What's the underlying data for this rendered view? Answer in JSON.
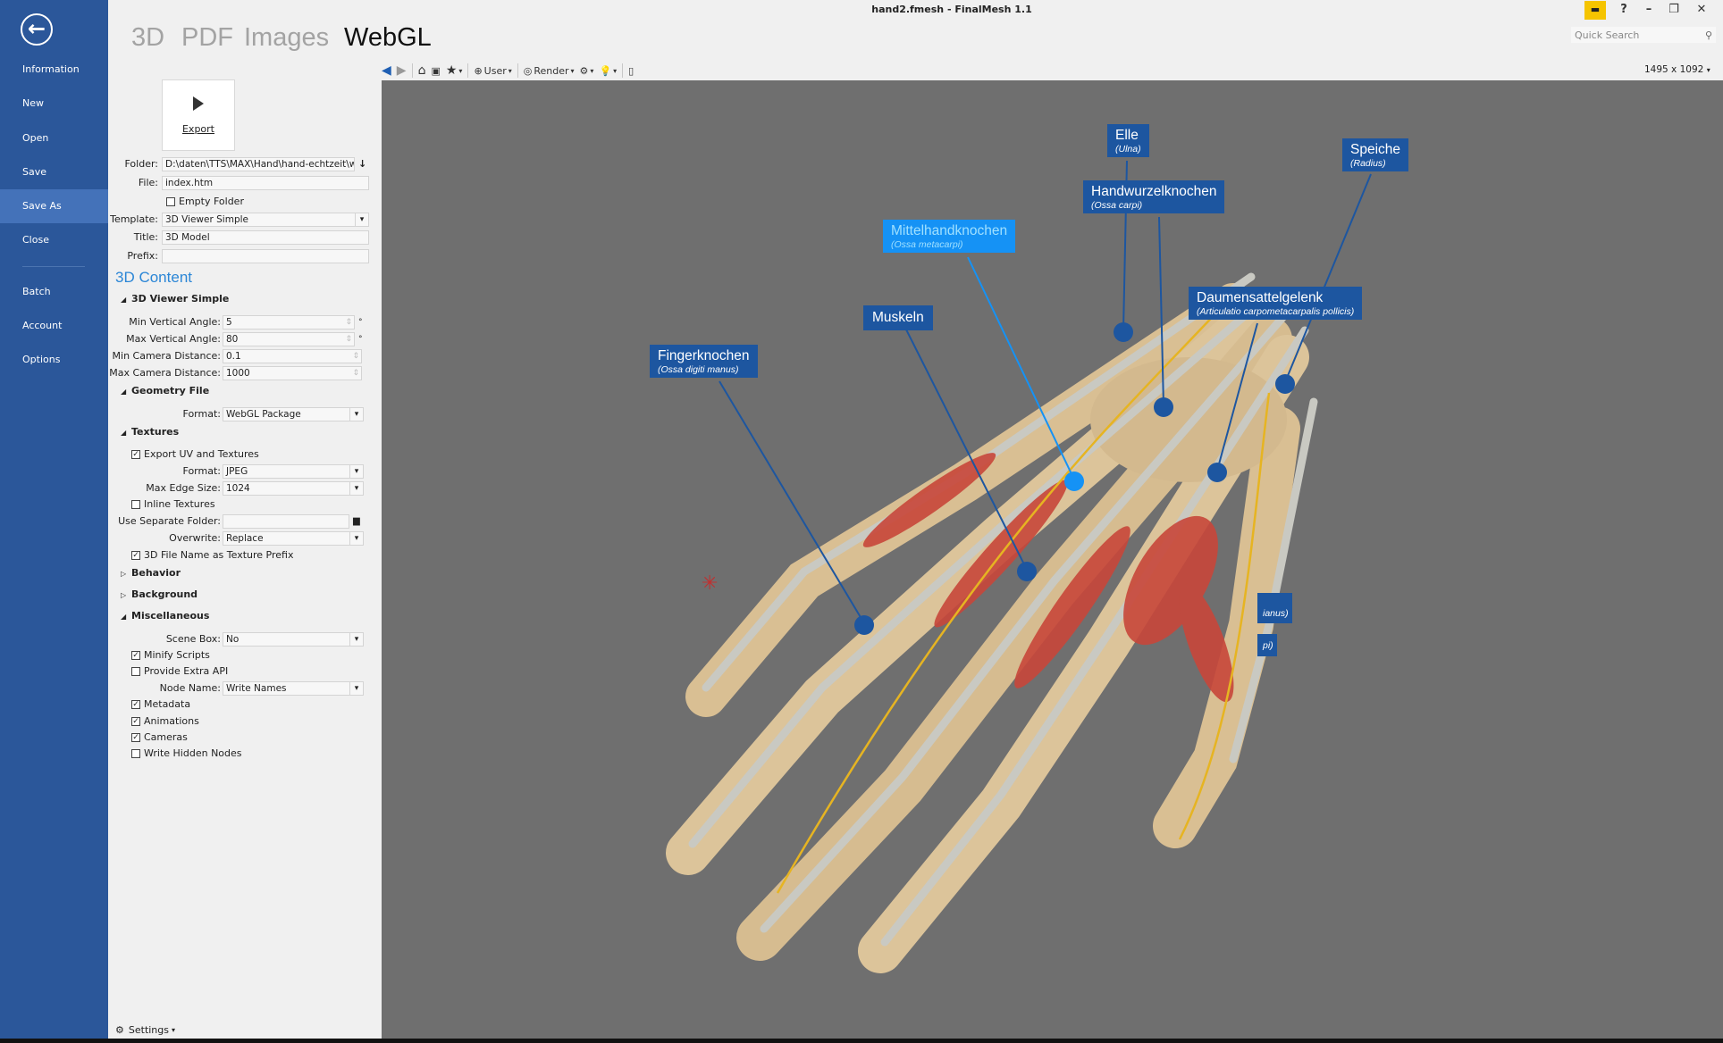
{
  "window": {
    "title": "hand2.fmesh - FinalMesh 1.1",
    "quick_search_placeholder": "Quick Search",
    "resolution": "1495 x 1092"
  },
  "colors": {
    "sidebar": "#2b579a",
    "sidebar_active": "#4472b9",
    "accent": "#2b86d6",
    "label_box": "#1d56a0",
    "label_box_highlight": "#1592f5",
    "viewport": "#6f6f6f"
  },
  "sidebar": {
    "items": [
      {
        "label": "Information"
      },
      {
        "label": "New"
      },
      {
        "label": "Open"
      },
      {
        "label": "Save"
      },
      {
        "label": "Save As",
        "active": true
      },
      {
        "label": "Close"
      },
      {
        "label": "Batch"
      },
      {
        "label": "Account"
      },
      {
        "label": "Options"
      }
    ]
  },
  "tabs": [
    {
      "label": "3D"
    },
    {
      "label": "PDF"
    },
    {
      "label": "Images"
    },
    {
      "label": "WebGL",
      "active": true
    }
  ],
  "export": {
    "label": "Export"
  },
  "form": {
    "folder": {
      "label": "Folder:",
      "value": "D:\\daten\\TTS\\MAX\\Hand\\hand-echtzeit\\wel"
    },
    "file": {
      "label": "File:",
      "value": "index.htm"
    },
    "empty_folder": {
      "label": "Empty Folder",
      "checked": false
    },
    "template": {
      "label": "Template:",
      "value": "3D Viewer Simple"
    },
    "title": {
      "label": "Title:",
      "value": "3D Model"
    },
    "prefix": {
      "label": "Prefix:",
      "value": ""
    }
  },
  "content": {
    "heading": "3D Content",
    "viewer": {
      "title": "3D Viewer Simple",
      "min_vertical_angle": {
        "label": "Min Vertical Angle:",
        "value": "5",
        "unit": "°"
      },
      "max_vertical_angle": {
        "label": "Max Vertical Angle:",
        "value": "80",
        "unit": "°"
      },
      "min_camera_distance": {
        "label": "Min Camera Distance:",
        "value": "0.1"
      },
      "max_camera_distance": {
        "label": "Max Camera Distance:",
        "value": "1000"
      }
    },
    "geometry": {
      "title": "Geometry File",
      "format": {
        "label": "Format:",
        "value": "WebGL Package"
      }
    },
    "textures": {
      "title": "Textures",
      "export_uv": {
        "label": "Export UV and Textures",
        "checked": true
      },
      "format": {
        "label": "Format:",
        "value": "JPEG"
      },
      "max_edge": {
        "label": "Max Edge Size:",
        "value": "1024"
      },
      "inline": {
        "label": "Inline Textures",
        "checked": false
      },
      "separate_folder": {
        "label": "Use Separate Folder:",
        "value": ""
      },
      "overwrite": {
        "label": "Overwrite:",
        "value": "Replace"
      },
      "prefix": {
        "label": "3D File Name as Texture Prefix",
        "checked": true
      }
    },
    "behavior": {
      "title": "Behavior"
    },
    "background": {
      "title": "Background"
    },
    "misc": {
      "title": "Miscellaneous",
      "scene_box": {
        "label": "Scene Box:",
        "value": "No"
      },
      "minify": {
        "label": "Minify Scripts",
        "checked": true
      },
      "extra_api": {
        "label": "Provide Extra API",
        "checked": false
      },
      "node_name": {
        "label": "Node Name:",
        "value": "Write Names"
      },
      "metadata": {
        "label": "Metadata",
        "checked": true
      },
      "animations": {
        "label": "Animations",
        "checked": true
      },
      "cameras": {
        "label": "Cameras",
        "checked": true
      },
      "hidden": {
        "label": "Write Hidden Nodes",
        "checked": false
      }
    }
  },
  "settings": {
    "label": "Settings"
  },
  "toolbar": {
    "user": "User",
    "render": "Render"
  },
  "annotations": [
    {
      "title": "Elle",
      "subtitle": "(Ulna)"
    },
    {
      "title": "Speiche",
      "subtitle": "(Radius)"
    },
    {
      "title": "Handwurzelknochen",
      "subtitle": "(Ossa carpi)"
    },
    {
      "title": "Mittelhandknochen",
      "subtitle": "(Ossa metacarpi)",
      "highlighted": true
    },
    {
      "title": "Daumensattelgelenk",
      "subtitle": "(Articulatio carpometacarpalis pollicis)"
    },
    {
      "title": "Muskeln",
      "subtitle": ""
    },
    {
      "title": "Fingerknochen",
      "subtitle": "(Ossa digiti manus)"
    },
    {
      "title": "",
      "subtitle": "ianus)"
    },
    {
      "title": "",
      "subtitle": "pi)"
    }
  ]
}
